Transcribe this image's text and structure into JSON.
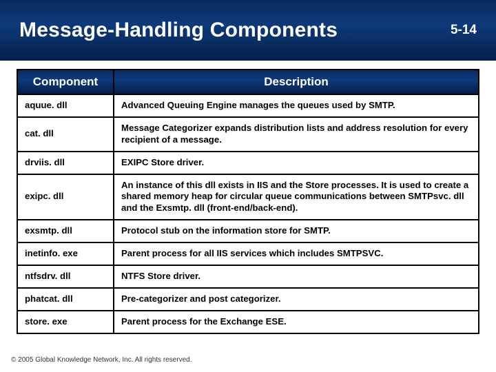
{
  "header": {
    "title": "Message-Handling Components",
    "page_number": "5-14"
  },
  "table": {
    "headers": {
      "component": "Component",
      "description": "Description"
    },
    "rows": [
      {
        "component": "aquue. dll",
        "description": "Advanced Queuing Engine manages the queues used by SMTP."
      },
      {
        "component": "cat. dll",
        "description": "Message Categorizer expands distribution lists and address resolution for every recipient of a message."
      },
      {
        "component": "drviis. dll",
        "description": "EXIPC Store driver."
      },
      {
        "component": "exipc. dll",
        "description": "An instance of this dll exists in IIS and the Store processes. It is used to create a shared memory heap for circular queue communications between SMTPsvc. dll and the Exsmtp. dll (front-end/back-end)."
      },
      {
        "component": "exsmtp. dll",
        "description": "Protocol stub on the information store for SMTP."
      },
      {
        "component": "inetinfo. exe",
        "description": "Parent process for all IIS services which includes SMTPSVC."
      },
      {
        "component": "ntfsdrv. dll",
        "description": "NTFS Store driver."
      },
      {
        "component": "phatcat. dll",
        "description": "Pre-categorizer and post categorizer."
      },
      {
        "component": "store. exe",
        "description": "Parent process for the Exchange ESE."
      }
    ]
  },
  "footer": "© 2005 Global Knowledge Network, Inc. All rights reserved."
}
